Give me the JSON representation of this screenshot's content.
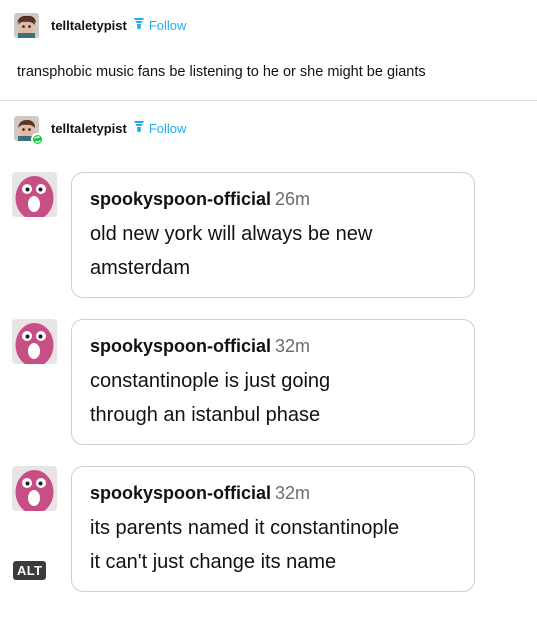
{
  "post": {
    "author": "telltaletypist",
    "follow_label": "Follow",
    "text": "transphobic music fans be listening to he or she might be giants"
  },
  "reblog": {
    "author": "telltaletypist",
    "follow_label": "Follow",
    "messages": [
      {
        "name": "spookyspoon-official",
        "time": "26m",
        "line1": "old new york will always be new",
        "line2": "amsterdam"
      },
      {
        "name": "spookyspoon-official",
        "time": "32m",
        "line1": "constantinople is just going",
        "line2": "through an istanbul phase"
      },
      {
        "name": "spookyspoon-official",
        "time": "32m",
        "line1": "its parents named it constantinople",
        "line2": "it can't just change its name"
      }
    ],
    "alt_label": "ALT"
  },
  "colors": {
    "follow": "#1eaef0",
    "reblog_badge": "#00cf35",
    "avatar_face": "#c64f86",
    "bubble_border": "#cfcfcf",
    "divider": "#e2e2e2"
  },
  "icons": {
    "follow": "follow-tower-icon",
    "reblog": "reblog-icon"
  }
}
